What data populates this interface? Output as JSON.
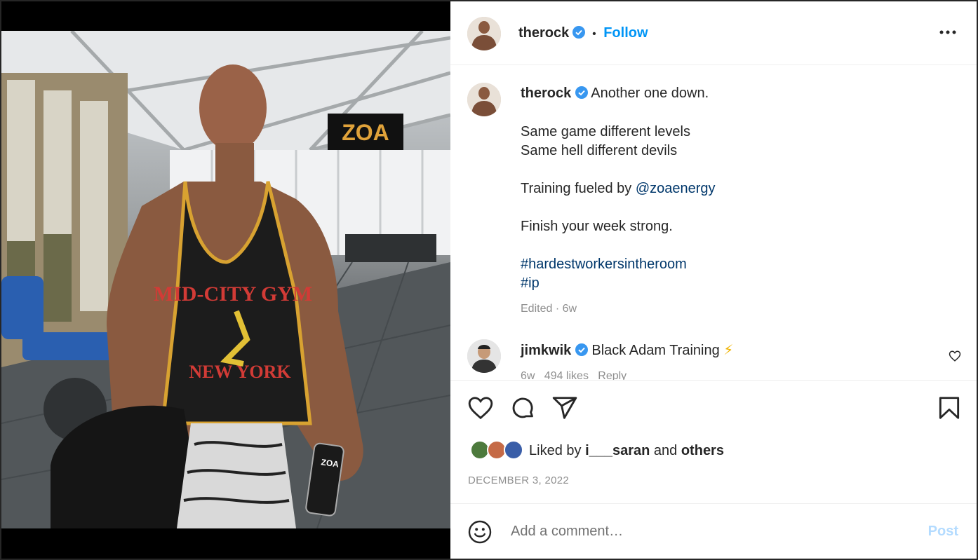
{
  "post_header": {
    "username": "therock",
    "separator": "•",
    "follow_label": "Follow"
  },
  "caption": {
    "username": "therock",
    "lines": [
      "Another one down.",
      "Same game different levels",
      "Same hell different devils",
      "Training fueled by ",
      "@zoaenergy",
      "Finish your week strong.",
      "#hardestworkersintheroom",
      "#ip"
    ],
    "meta": "Edited · 6w"
  },
  "comment": {
    "username": "jimkwik",
    "text": "Black Adam Training",
    "emoji": "⚡",
    "meta": "6w   494 likes   Reply"
  },
  "photo": {
    "gym_sign": "ZOA",
    "shirt_top": "MID-CITY GYM",
    "shirt_bottom": "NEW YORK",
    "can_label": "ZOA"
  },
  "likes": {
    "prefix": "Liked by ",
    "user": "i___saran",
    "and": " and ",
    "others": "others"
  },
  "date": "DECEMBER 3, 2022",
  "add_comment": {
    "placeholder": "Add a comment…",
    "post_label": "Post"
  },
  "colors": {
    "follow_blue": "#0095f6",
    "verified_blue": "#3897f0",
    "link_navy": "#00376b",
    "post_disabled": "#b3dbff"
  },
  "icons": [
    "more-options-icon",
    "verified-icon",
    "heart-icon",
    "comment-icon",
    "share-icon",
    "bookmark-icon",
    "emoji-icon",
    "comment-like-icon"
  ]
}
